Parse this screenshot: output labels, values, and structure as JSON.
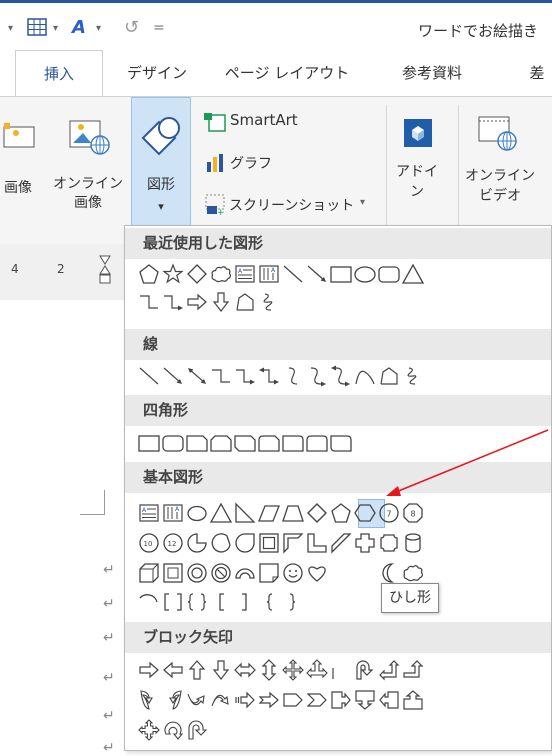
{
  "title_bar": {
    "document_title": "ワードでお絵描き"
  },
  "tabs": [
    {
      "label": "挿入",
      "active": true
    },
    {
      "label": "デザイン",
      "active": false
    },
    {
      "label": "ページ レイアウト",
      "active": false
    },
    {
      "label": "参考資料",
      "active": false
    },
    {
      "label": "差",
      "active": false
    }
  ],
  "ribbon": {
    "image_label": "画像",
    "online_image_label_1": "オンライン",
    "online_image_label_2": "画像",
    "shapes_label": "図形",
    "smartart_label": "SmartArt",
    "graph_label": "グラフ",
    "screenshot_label": "スクリーンショット",
    "addin_label_1": "アドイ",
    "addin_label_2": "ン",
    "online_video_label_1": "オンライン",
    "online_video_label_2": "ビデオ",
    "caret": "▾"
  },
  "ruler": {
    "num1": "4",
    "num2": "2"
  },
  "gallery": {
    "sections": [
      {
        "title": "最近使用した図形"
      },
      {
        "title": "線"
      },
      {
        "title": "四角形"
      },
      {
        "title": "基本図形"
      },
      {
        "title": "ブロック矢印"
      }
    ],
    "tooltip": "ひし形",
    "selected_shape": "diamond"
  },
  "colors": {
    "accent": "#2b579a",
    "selected": "#cde2f7",
    "annotation_arrow": "#e8151b"
  }
}
